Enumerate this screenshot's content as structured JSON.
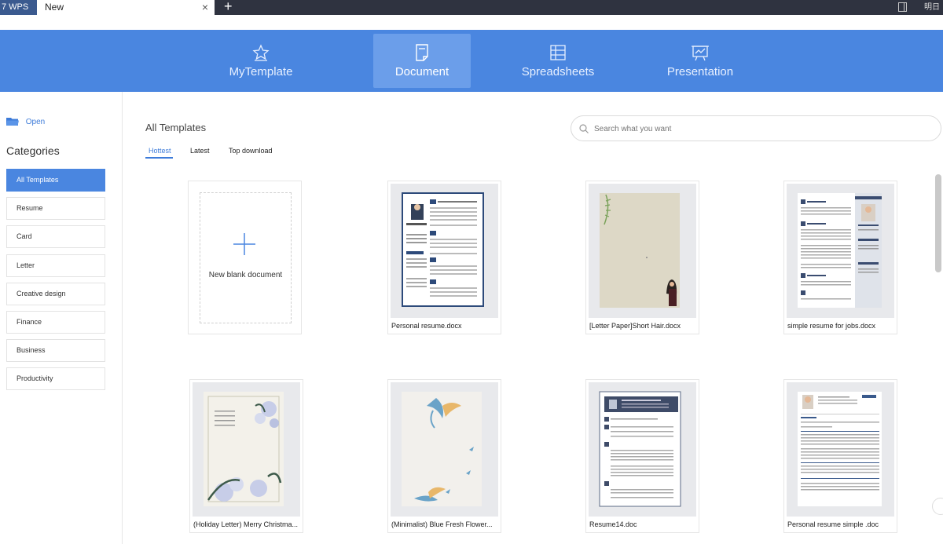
{
  "titlebar": {
    "app_label": "7 WPS",
    "tab_title": "New",
    "close_symbol": "×",
    "new_tab_symbol": "+",
    "right_text": "明日"
  },
  "header": {
    "tabs": [
      {
        "label": "MyTemplate",
        "icon": "star-template-icon"
      },
      {
        "label": "Document",
        "icon": "document-icon",
        "active": true
      },
      {
        "label": "Spreadsheets",
        "icon": "spreadsheet-grid-icon"
      },
      {
        "label": "Presentation",
        "icon": "presentation-board-icon"
      }
    ]
  },
  "sidebar": {
    "open_label": "Open",
    "categories_title": "Categories",
    "items": [
      {
        "label": "All Templates",
        "active": true
      },
      {
        "label": "Resume"
      },
      {
        "label": "Card"
      },
      {
        "label": "Letter"
      },
      {
        "label": "Creative design"
      },
      {
        "label": "Finance"
      },
      {
        "label": "Business"
      },
      {
        "label": "Productivity"
      }
    ]
  },
  "main": {
    "title": "All Templates",
    "search_placeholder": "Search what you want",
    "subtabs": [
      {
        "label": "Hottest",
        "active": true
      },
      {
        "label": "Latest"
      },
      {
        "label": "Top download"
      }
    ],
    "blank_label": "New blank document",
    "templates": [
      {
        "name": "Personal resume.docx"
      },
      {
        "name": "[Letter Paper]Short Hair.docx"
      },
      {
        "name": "simple resume for jobs.docx"
      },
      {
        "name": "(Holiday Letter) Merry Christma..."
      },
      {
        "name": "(Minimalist) Blue Fresh Flower..."
      },
      {
        "name": "Resume14.doc"
      },
      {
        "name": "Personal resume simple .doc"
      }
    ]
  },
  "colors": {
    "accent": "#4a86e0",
    "titlebar": "#2f3340",
    "active_tab_bg": "#6b9eea"
  }
}
